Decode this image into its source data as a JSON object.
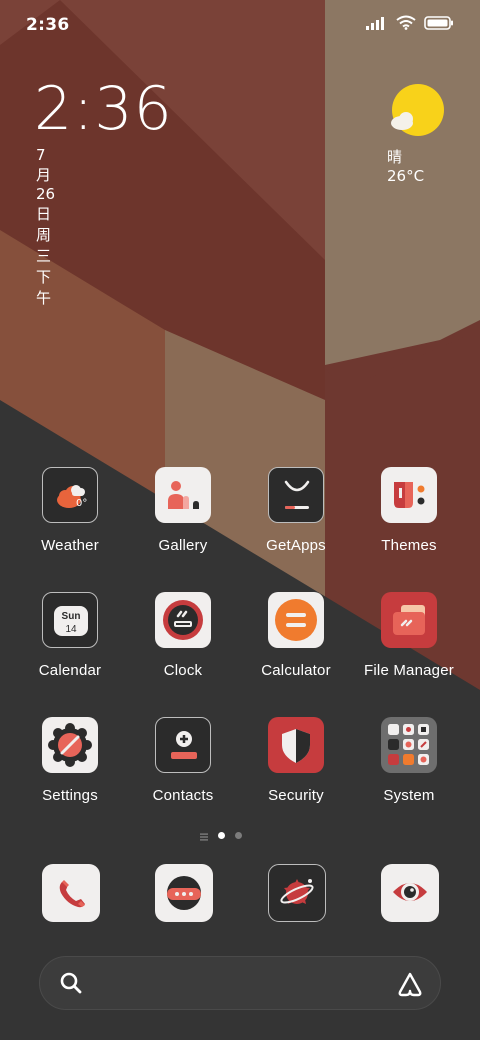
{
  "status_bar": {
    "time": "2:36",
    "icons": [
      "signal-icon",
      "wifi-icon",
      "battery-icon"
    ]
  },
  "clock_widget": {
    "time": "2:36",
    "date": "7月26日 周三下午"
  },
  "weather_widget": {
    "text": "晴 26°C",
    "icon": "sun-cloud-icon"
  },
  "weather_app_badge": "0°",
  "calendar_app_icon": {
    "day": "Sun",
    "date": "14"
  },
  "apps": [
    {
      "label": "Weather"
    },
    {
      "label": "Gallery"
    },
    {
      "label": "GetApps"
    },
    {
      "label": "Themes"
    },
    {
      "label": "Calendar"
    },
    {
      "label": "Clock"
    },
    {
      "label": "Calculator"
    },
    {
      "label": "File Manager"
    },
    {
      "label": "Settings"
    },
    {
      "label": "Contacts"
    },
    {
      "label": "Security"
    },
    {
      "label": "System"
    }
  ],
  "page_indicator": {
    "pages": 2,
    "current": 1
  },
  "dock": [
    "phone-icon",
    "messages-icon",
    "browser-icon",
    "camera-icon"
  ],
  "colors": {
    "accent_red": "#c63c3e",
    "accent_orange": "#f07b2e",
    "tile_light": "#f1efee",
    "tile_dark": "#2b2b2b"
  }
}
